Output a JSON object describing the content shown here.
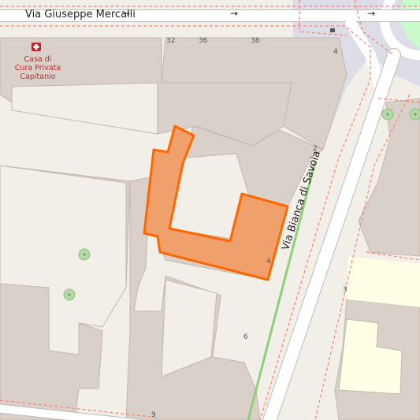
{
  "map": {
    "colors": {
      "background": "#f2efe9",
      "building": "#d9d0c9",
      "building_outline": "#c4b6ab",
      "road": "#ffffff",
      "road_casing": "#bbbbbb",
      "pedestrian_area": "#dddde8",
      "footway": "#fa8072",
      "cycleway": "#8fcf7a",
      "highlight_fill": "#f0a06a",
      "highlight_stroke": "#ff6600",
      "school_area": "#ffffe5",
      "park": "#c8facc",
      "tree": "#b6d7a8",
      "poi": "#c0272d"
    },
    "streets": [
      {
        "name": "Via Giuseppe Mercalli"
      },
      {
        "name": "Via Bianca di Savoia"
      }
    ],
    "house_numbers": [
      "32",
      "36",
      "38",
      "4",
      "2",
      "4",
      "3",
      "6",
      "9"
    ],
    "poi": {
      "icon": "hospital-cross-icon",
      "lines": [
        "Casa di",
        "Cura Privata",
        "Capitanio"
      ]
    },
    "oneway_arrows": [
      "→",
      "→",
      "→"
    ]
  }
}
